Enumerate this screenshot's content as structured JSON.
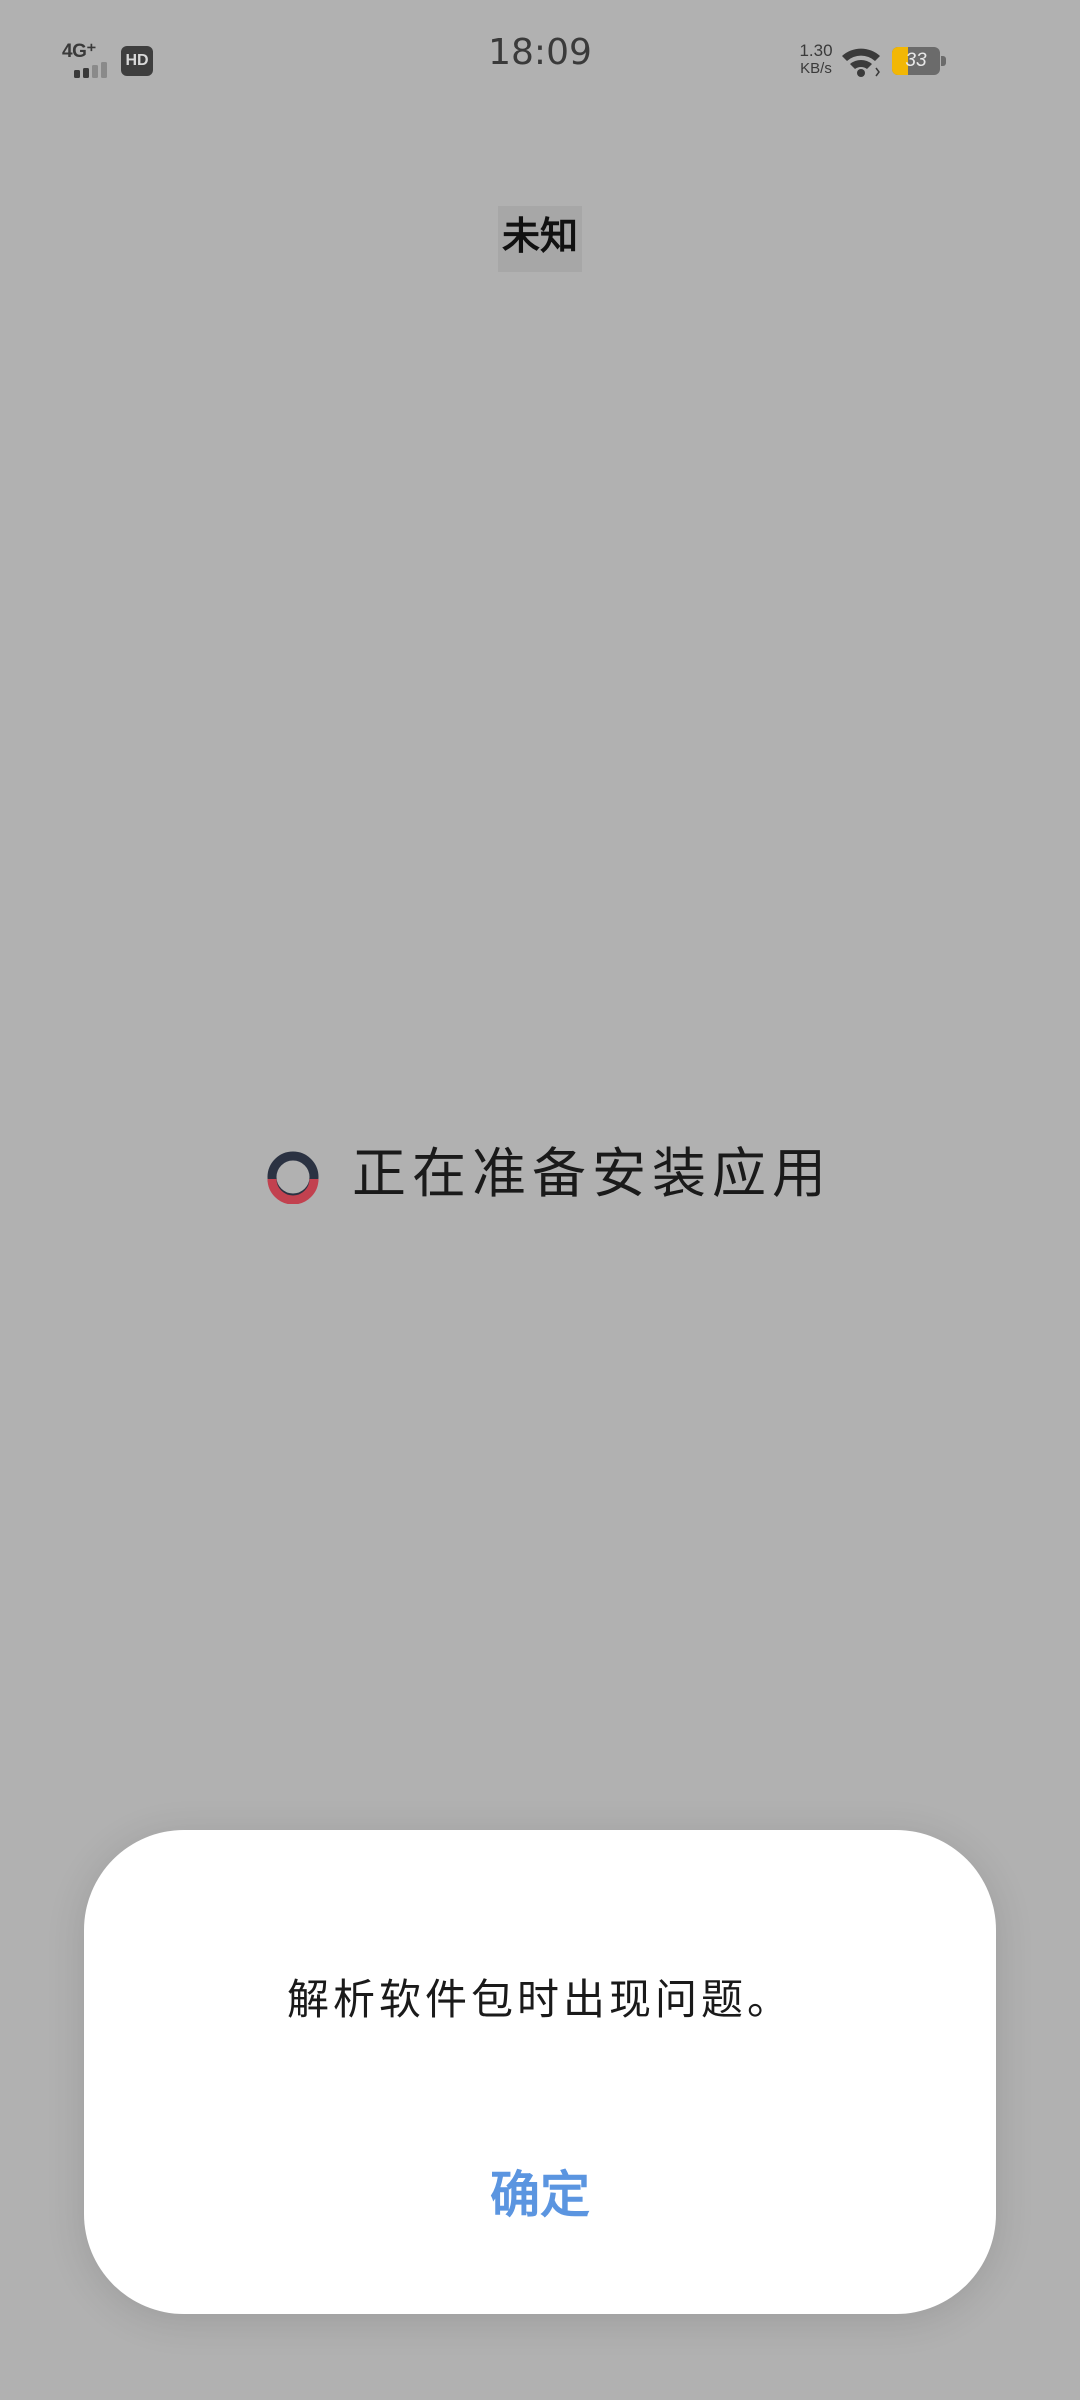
{
  "status_bar": {
    "network_type": "4G⁺",
    "hd_badge": "HD",
    "time": "18:09",
    "net_speed_value": "1.30",
    "net_speed_unit": "KB/s",
    "battery_level": "33",
    "battery_fraction": 0.33,
    "battery_fill_color": "#f2b705",
    "icons": [
      "signal-icon",
      "wifi-icon",
      "battery-icon"
    ]
  },
  "app": {
    "title": "未知"
  },
  "install": {
    "status_text": "正在准备安装应用",
    "spinner_colors": {
      "ring": "#2b3242",
      "arc": "#c2414f"
    }
  },
  "dialog": {
    "message": "解析软件包时出现问题。",
    "confirm_label": "确定",
    "confirm_color": "#5b95e0"
  }
}
